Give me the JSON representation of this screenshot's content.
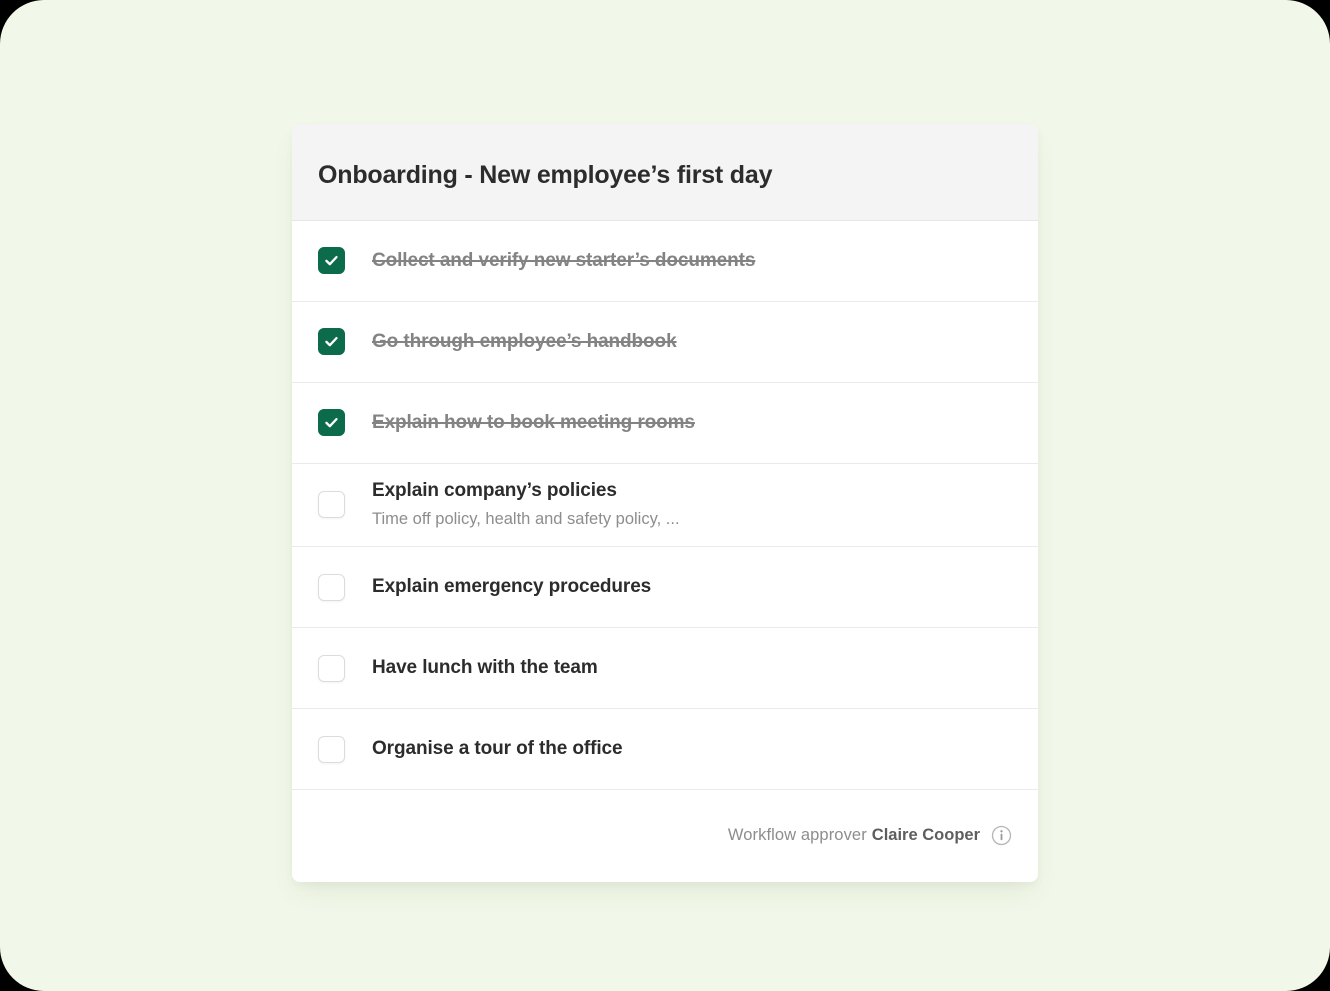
{
  "theme": {
    "page_background": "#f2f8e9",
    "card_background": "#ffffff",
    "header_background": "#f4f4f4",
    "accent_checked": "#0c6b4a",
    "title_color": "#2c2c2c",
    "muted_color": "#8d8d8d",
    "done_color": "#838383",
    "divider_color": "#eaeaea"
  },
  "card": {
    "header": {
      "title": "Onboarding - New employee’s first day"
    },
    "tasks": [
      {
        "title": "Collect and verify new starter’s documents",
        "subtitle": "",
        "checked": true,
        "checkbox_icon": "checkbox-checked-icon"
      },
      {
        "title": "Go through employee’s handbook",
        "subtitle": "",
        "checked": true,
        "checkbox_icon": "checkbox-checked-icon"
      },
      {
        "title": "Explain how to book meeting rooms",
        "subtitle": "",
        "checked": true,
        "checkbox_icon": "checkbox-checked-icon"
      },
      {
        "title": "Explain company’s policies",
        "subtitle": "Time off policy, health and safety policy, ...",
        "checked": false,
        "checkbox_icon": "checkbox-unchecked-icon"
      },
      {
        "title": "Explain emergency procedures",
        "subtitle": "",
        "checked": false,
        "checkbox_icon": "checkbox-unchecked-icon"
      },
      {
        "title": "Have lunch with the team",
        "subtitle": "",
        "checked": false,
        "checkbox_icon": "checkbox-unchecked-icon"
      },
      {
        "title": "Organise a tour of the office",
        "subtitle": "",
        "checked": false,
        "checkbox_icon": "checkbox-unchecked-icon"
      }
    ],
    "footer": {
      "approver_label": "Workflow approver",
      "approver_name": "Claire Cooper",
      "info_icon": "info-circle-icon"
    }
  }
}
